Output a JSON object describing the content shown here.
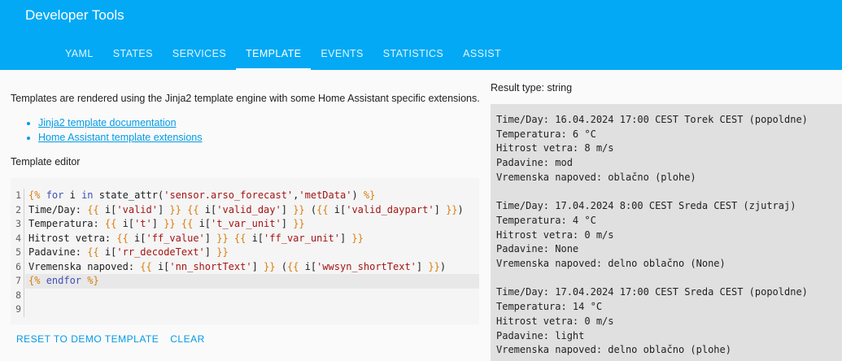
{
  "app": {
    "title": "Developer Tools"
  },
  "tabs": [
    "YAML",
    "STATES",
    "SERVICES",
    "TEMPLATE",
    "EVENTS",
    "STATISTICS",
    "ASSIST"
  ],
  "active_tab": "TEMPLATE",
  "intro": "Templates are rendered using the Jinja2 template engine with some Home Assistant specific extensions.",
  "links": [
    "Jinja2 template documentation",
    "Home Assistant template extensions"
  ],
  "editor": {
    "label": "Template editor",
    "lines": [
      "{% for i in state_attr('sensor.arso_forecast','metData') %}",
      "Time/Day: {{ i['valid'] }} {{ i['valid_day'] }} ({{ i['valid_daypart'] }})",
      "Temperatura: {{ i['t'] }} {{ i['t_var_unit'] }}",
      "Hitrost vetra: {{ i['ff_value'] }} {{ i['ff_var_unit'] }}",
      "Padavine: {{ i['rr_decodeText'] }}",
      "Vremenska napoved: {{ i['nn_shortText'] }} ({{ i['wwsyn_shortText'] }})",
      "{% endfor %}",
      "",
      ""
    ],
    "line_numbers": [
      "1",
      "2",
      "3",
      "4",
      "5",
      "6",
      "7",
      "8",
      "9"
    ],
    "active_line": 7
  },
  "buttons": {
    "reset": "RESET TO DEMO TEMPLATE",
    "clear": "CLEAR"
  },
  "result": {
    "type_label": "Result type: string",
    "text": "Time/Day: 16.04.2024 17:00 CEST Torek CEST (popoldne)\nTemperatura: 6 °C\nHitrost vetra: 8 m/s\nPadavine: mod\nVremenska napoved: oblačno (plohe)\n\nTime/Day: 17.04.2024 8:00 CEST Sreda CEST (zjutraj)\nTemperatura: 4 °C\nHitrost vetra: 0 m/s\nPadavine: None\nVremenska napoved: delno oblačno (None)\n\nTime/Day: 17.04.2024 17:00 CEST Sreda CEST (popoldne)\nTemperatura: 14 °C\nHitrost vetra: 0 m/s\nPadavine: light\nVremenska napoved: delno oblačno (plohe)"
  },
  "colors": {
    "header": "#03a9f4",
    "link": "#039be5",
    "editor_bg": "#f5f5f5",
    "result_bg": "#e0e0e0"
  }
}
